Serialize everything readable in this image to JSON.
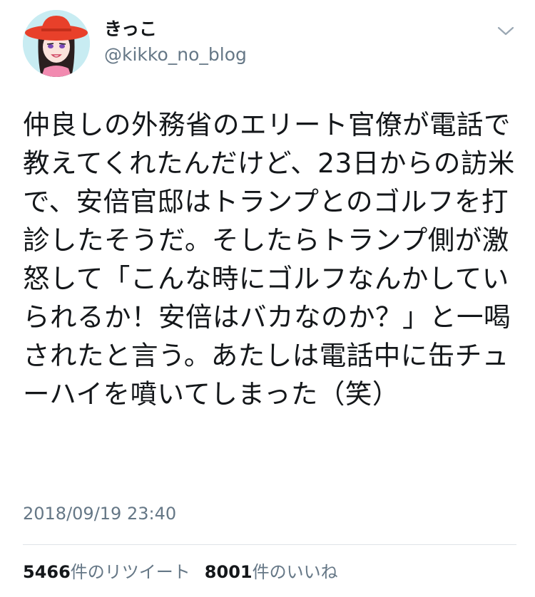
{
  "author": {
    "display_name": "きっこ",
    "handle": "@kikko_no_blog",
    "avatar_icon": "cartoon-woman-red-hat-avatar"
  },
  "menu": {
    "icon": "chevron-down-icon"
  },
  "tweet": {
    "text": "仲良しの外務省のエリート官僚が電話で教えてくれたんだけど、23日からの訪米で、安倍官邸はトランプとのゴルフを打診したそうだ。そしたらトランプ側が激怒して「こんな時にゴルフなんかしていられるか！安倍はバカなのか？」と一喝されたと言う。あたしは電話中に缶チューハイを噴いてしまった（笑）",
    "timestamp": "2018/09/19 23:40"
  },
  "stats": {
    "retweets_count": "5466",
    "retweets_label": "件のリツイート",
    "likes_count": "8001",
    "likes_label": "件のいいね"
  },
  "colors": {
    "text_primary": "#14171a",
    "text_secondary": "#657786",
    "divider": "#dfe3e7",
    "avatar_bg": "#c8ecf2",
    "hat_red": "#e8402a"
  }
}
